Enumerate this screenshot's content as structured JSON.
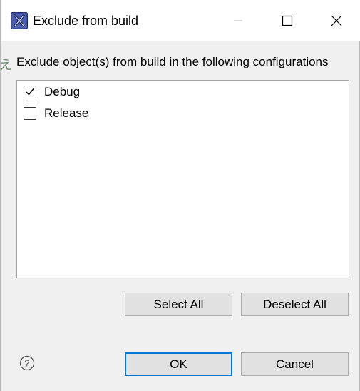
{
  "window": {
    "title": "Exclude from build",
    "app_icon": "x-app-icon",
    "controls": [
      "minimize-icon",
      "maximize-icon",
      "close-icon"
    ]
  },
  "background_glyph": "え",
  "prompt": "Exclude object(s) from build in the following configurations",
  "configurations": [
    {
      "label": "Debug",
      "checked": true
    },
    {
      "label": "Release",
      "checked": false
    }
  ],
  "buttons": {
    "select_all": "Select All",
    "deselect_all": "Deselect All",
    "ok": "OK",
    "cancel": "Cancel"
  },
  "help": {
    "icon": "help-icon"
  },
  "colors": {
    "focus_border": "#0078d7",
    "app_icon_blue": "#3d4e9a",
    "dialog_bg": "#f0f0f0"
  }
}
